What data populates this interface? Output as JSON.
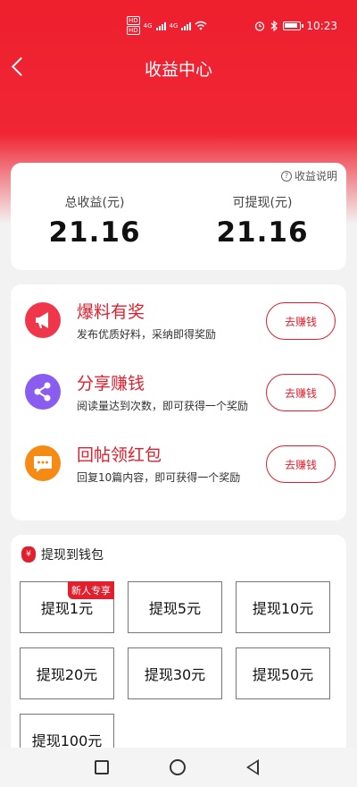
{
  "status_bar": {
    "time": "10:23",
    "hd_badges": [
      "HD",
      "HD"
    ],
    "network": [
      "4G",
      "4G"
    ],
    "icons": [
      "signal-icon",
      "signal-icon",
      "wifi-icon",
      "alarm-icon",
      "bluetooth-icon",
      "battery-icon"
    ]
  },
  "header": {
    "title": "收益中心",
    "back_icon": "chevron-left-icon"
  },
  "summary": {
    "explain_label": "收益说明",
    "total_label": "总收益(元)",
    "total_value": "21.16",
    "withdrawable_label": "可提现(元)",
    "withdrawable_value": "21.16"
  },
  "tasks": [
    {
      "title": "爆料有奖",
      "desc": "发布优质好料，采纳即得奖励",
      "button": "去赚钱",
      "icon": "megaphone-icon",
      "color": "#f0364a"
    },
    {
      "title": "分享赚钱",
      "desc": "阅读量达到次数，即可获得一个奖励",
      "button": "去赚钱",
      "icon": "share-icon",
      "color": "#8a5cf0"
    },
    {
      "title": "回帖领红包",
      "desc": "回复10篇内容，即可获得一个奖励",
      "button": "去赚钱",
      "icon": "comment-icon",
      "color": "#f58a14"
    }
  ],
  "withdraw": {
    "title": "提现到钱包",
    "icon": "money-bag-icon",
    "new_user_tag": "新人专享",
    "options": [
      "提现1元",
      "提现5元",
      "提现10元",
      "提现20元",
      "提现30元",
      "提现50元",
      "提现100元"
    ]
  },
  "system_nav": [
    "recent-apps-icon",
    "home-icon",
    "back-icon"
  ],
  "colors": {
    "brand_red": "#e0202e",
    "hero_red": "#ee1f2e"
  }
}
